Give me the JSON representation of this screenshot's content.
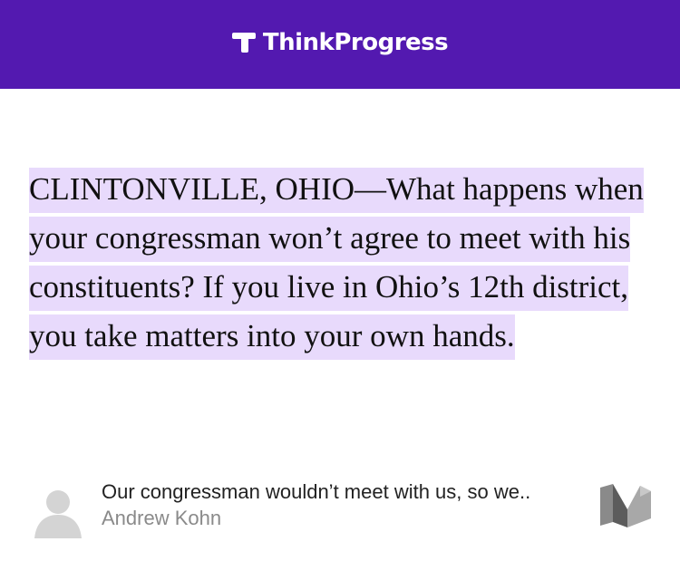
{
  "header": {
    "brand_name": "ThinkProgress",
    "logo_icon": "think-progress-t-icon",
    "background_color": "#5319b0"
  },
  "article": {
    "quote": "CLINTONVILLE, OHIO—What happens when your congressman won’t agree to meet with his constituents? If you live in Ohio’s 12th district, you take matters into your own hands.",
    "highlight_color": "#e8dafc"
  },
  "link_card": {
    "title": "Our congressman wouldn’t meet with us, so we..",
    "author": "Andrew Kohn",
    "avatar_icon": "default-avatar-icon",
    "publisher_icon": "medium-logo-icon"
  }
}
